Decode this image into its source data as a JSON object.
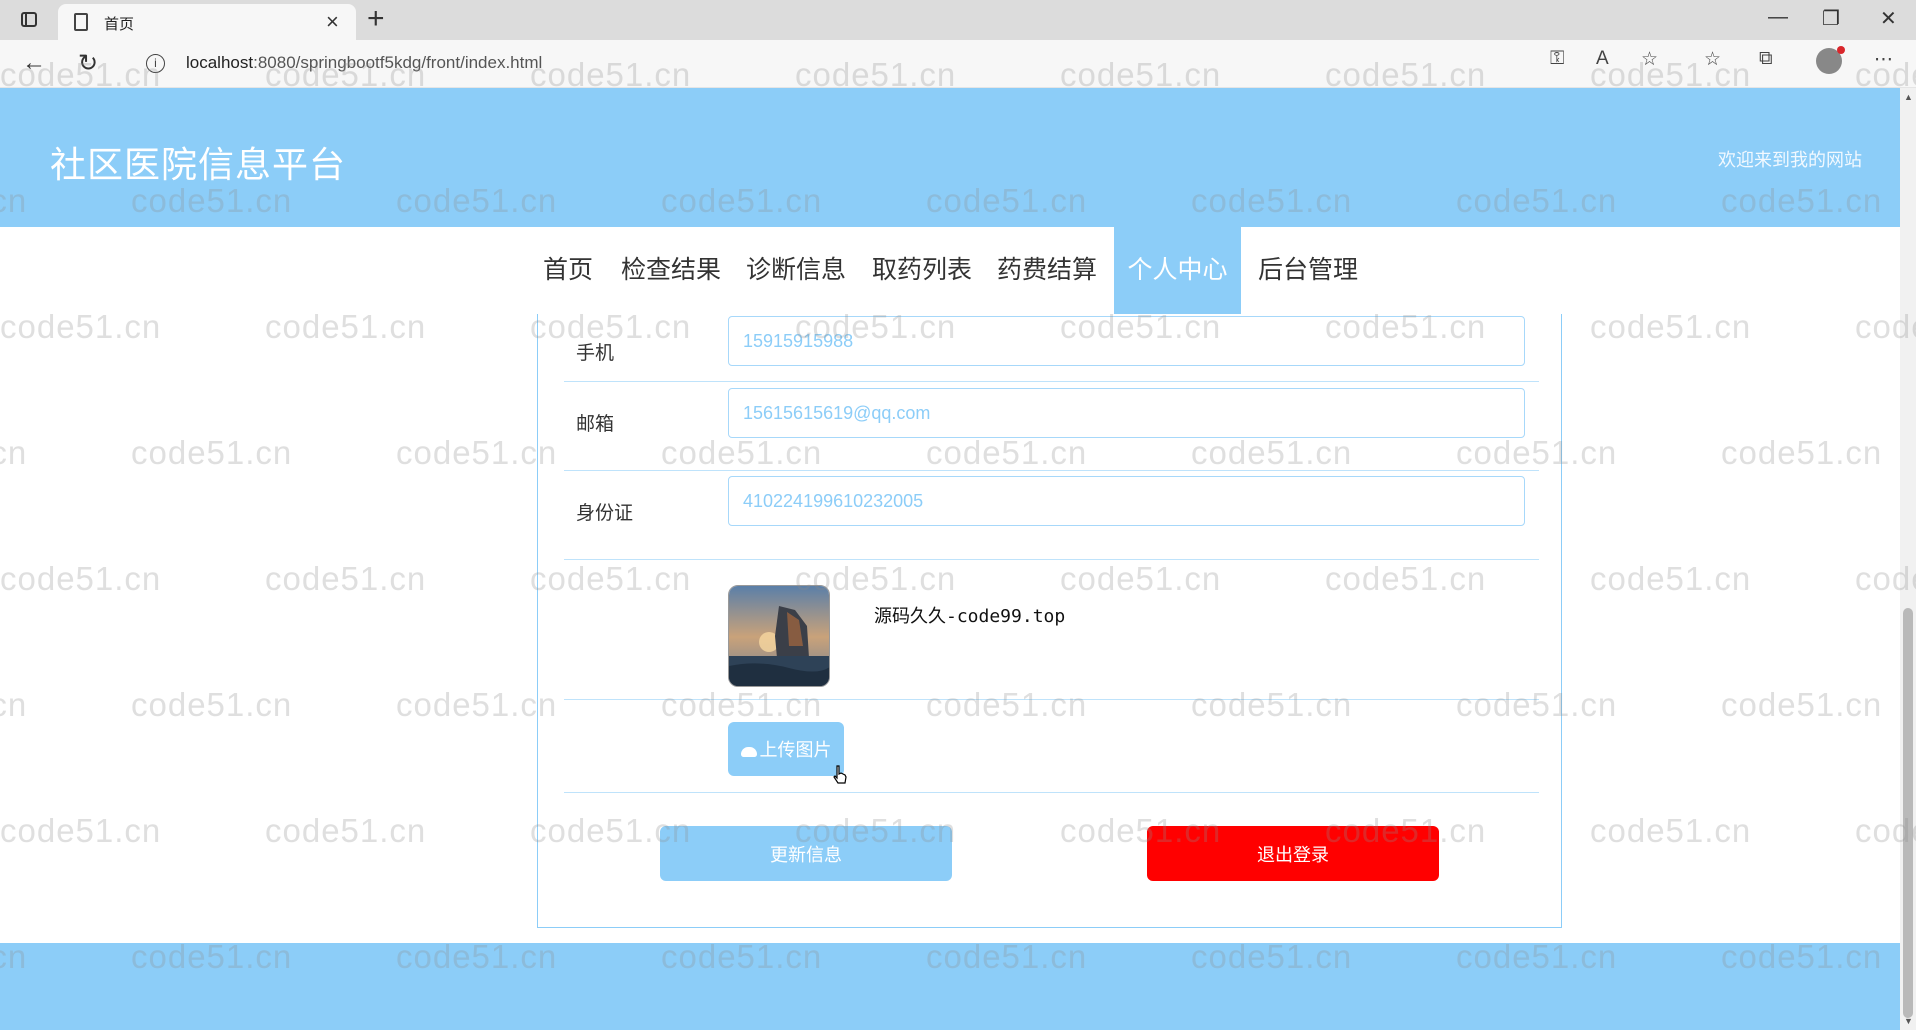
{
  "browser": {
    "tab_title": "首页",
    "tab_close": "×",
    "new_tab": "+",
    "url_host": "localhost",
    "url_path": ":8080/springbootf5kdg/front/index.html",
    "minimize": "—",
    "maximize": "❐",
    "close": "✕",
    "back": "←",
    "reload": "↻"
  },
  "site": {
    "title": "社区医院信息平台",
    "welcome": "欢迎来到我的网站"
  },
  "nav": {
    "items": [
      {
        "label": "首页"
      },
      {
        "label": "检查结果"
      },
      {
        "label": "诊断信息"
      },
      {
        "label": "取药列表"
      },
      {
        "label": "药费结算"
      },
      {
        "label": "个人中心",
        "active": true
      },
      {
        "label": "后台管理"
      }
    ]
  },
  "form": {
    "phone_label": "手机",
    "phone_value": "15915915988",
    "email_label": "邮箱",
    "email_value": "15615615619@qq.com",
    "idcard_label": "身份证",
    "idcard_value": "410224199610232005",
    "upload_label": "上传图片",
    "update_label": "更新信息",
    "logout_label": "退出登录"
  },
  "overlay_text": "源码久久-code99.top",
  "watermark": "code51.cn",
  "colors": {
    "primary": "#8ccdf8",
    "danger": "#ff0000",
    "tabbar": "#dcdcdc"
  }
}
